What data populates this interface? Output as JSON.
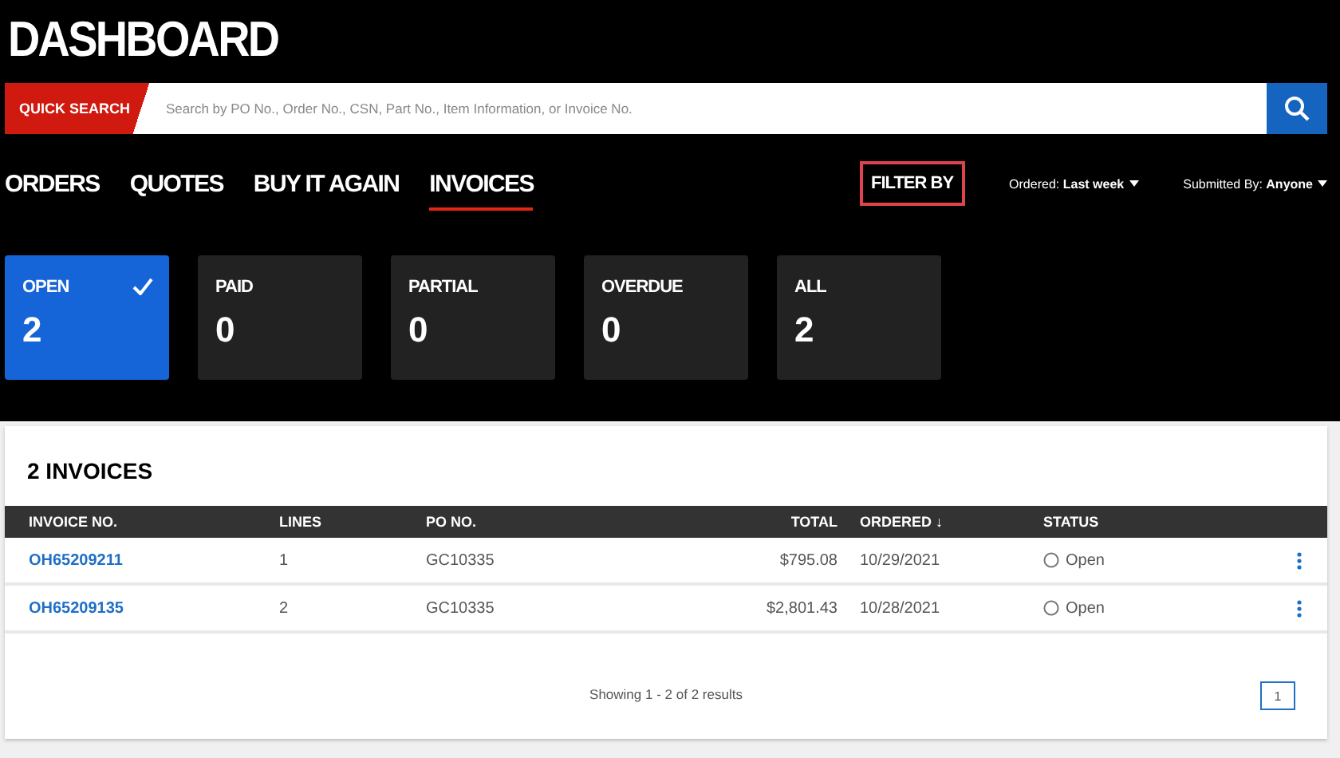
{
  "title": "DASHBOARD",
  "search": {
    "label": "QUICK SEARCH",
    "placeholder": "Search by PO No., Order No., CSN, Part No., Item Information, or Invoice No."
  },
  "tabs": [
    {
      "label": "ORDERS",
      "selected": false
    },
    {
      "label": "QUOTES",
      "selected": false
    },
    {
      "label": "BUY IT AGAIN",
      "selected": false
    },
    {
      "label": "INVOICES",
      "selected": true
    }
  ],
  "filter_by": "FILTER BY",
  "filters": [
    {
      "label": "Ordered:",
      "value": "Last week"
    },
    {
      "label": "Submitted By:",
      "value": "Anyone"
    }
  ],
  "tiles": [
    {
      "label": "OPEN",
      "count": "2",
      "selected": true
    },
    {
      "label": "PAID",
      "count": "0",
      "selected": false
    },
    {
      "label": "PARTIAL",
      "count": "0",
      "selected": false
    },
    {
      "label": "OVERDUE",
      "count": "0",
      "selected": false
    },
    {
      "label": "ALL",
      "count": "2",
      "selected": false
    }
  ],
  "table": {
    "title": "2 INVOICES",
    "columns": [
      "INVOICE NO.",
      "LINES",
      "PO NO.",
      "TOTAL",
      "ORDERED ↓",
      "STATUS"
    ],
    "rows": [
      {
        "invoice": "OH65209211",
        "lines": "1",
        "po": "GC10335",
        "total": "$795.08",
        "ordered": "10/29/2021",
        "status": "Open"
      },
      {
        "invoice": "OH65209135",
        "lines": "2",
        "po": "GC10335",
        "total": "$2,801.43",
        "ordered": "10/28/2021",
        "status": "Open"
      }
    ],
    "summary": "Showing 1 - 2 of 2 results",
    "pages": [
      {
        "label": "1",
        "selected": true
      }
    ]
  }
}
